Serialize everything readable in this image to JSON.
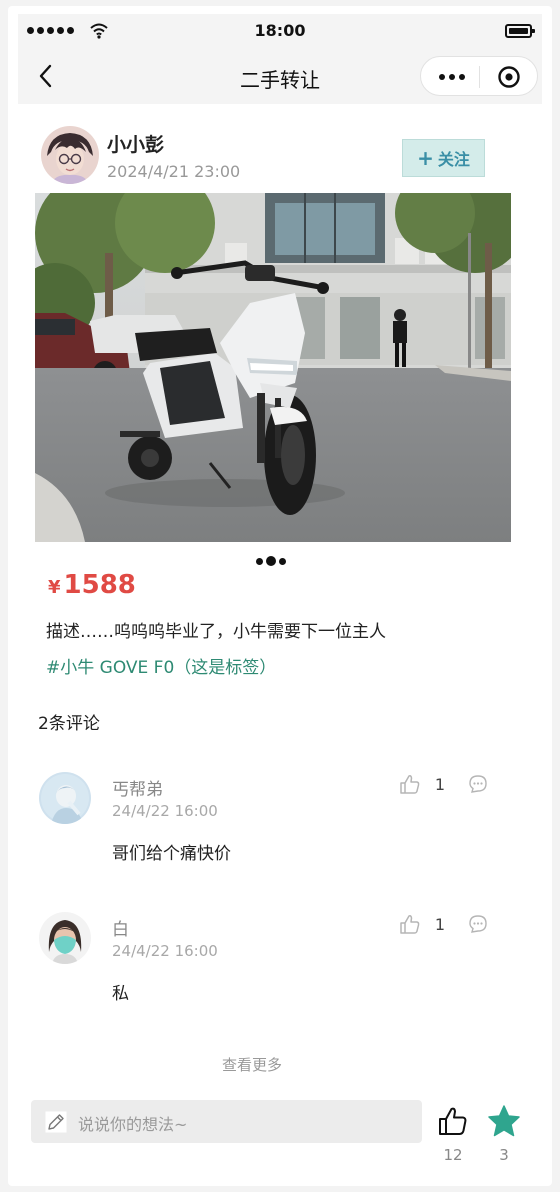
{
  "status": {
    "time": "18:00"
  },
  "nav": {
    "title": "二手转让"
  },
  "post": {
    "author": "小小彭",
    "time": "2024/4/21 23:00",
    "follow_label": "关注",
    "price_currency": "¥",
    "price": "1588",
    "description": "描述……呜呜呜毕业了，小牛需要下一位主人",
    "tags": "#小牛 GOVE F0（这是标签）",
    "image_count": 3,
    "current_image": 2
  },
  "comments": {
    "count_label": "2条评论",
    "items": [
      {
        "name": "丐帮弟",
        "time": "24/4/22 16:00",
        "text": "哥们给个痛快价",
        "likes": "1"
      },
      {
        "name": "白",
        "time": "24/4/22 16:00",
        "text": "私",
        "likes": "1"
      }
    ],
    "more_label": "查看更多"
  },
  "bottom": {
    "placeholder": "说说你的想法~",
    "likes": "12",
    "favorites": "3"
  },
  "colors": {
    "price": "#e04a44",
    "tag": "#2e8a73",
    "follow_bg": "#d4ecea",
    "follow_text": "#3a8fa6",
    "star": "#2fa58e"
  }
}
